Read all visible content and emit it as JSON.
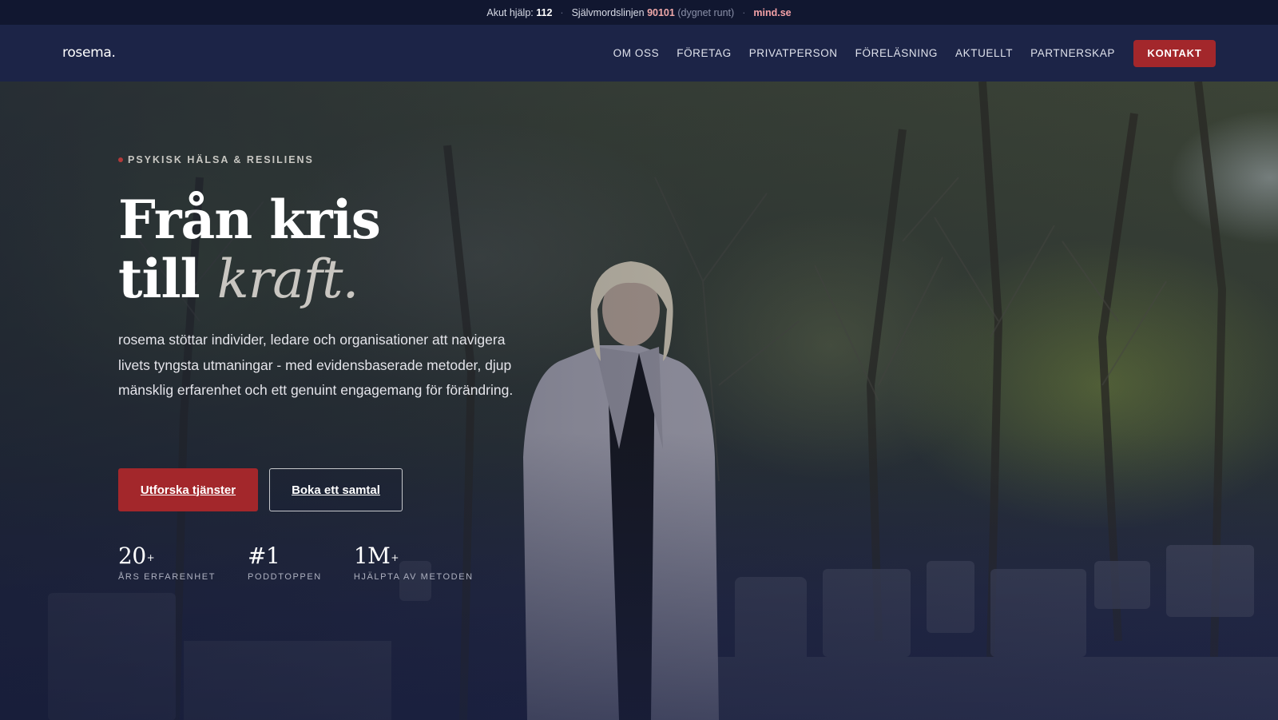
{
  "topbar": {
    "acute_label": "Akut hjälp:",
    "acute_number": "112",
    "separator": "·",
    "suicide_label": "Självmordslinjen",
    "suicide_number": "90101",
    "suicide_note": "(dygnet runt)",
    "link": "mind.se"
  },
  "nav": {
    "logo": "rosema.",
    "items": [
      "OM OSS",
      "FÖRETAG",
      "PRIVATPERSON",
      "FÖRELÄSNING",
      "AKTUELLT",
      "PARTNERSKAP"
    ],
    "cta": "KONTAKT"
  },
  "hero": {
    "eyebrow": "PSYKISK HÄLSA & RESILIENS",
    "headline_line1": "Från kris",
    "headline_line2_plain": "till",
    "headline_line2_italic": "kraft.",
    "lead": "rosema stöttar individer, ledare och organisationer att navigera livets tyngsta utmaningar - med evidensbaserade metoder, djup mänsklig erfarenhet och ett genuint engagemang för förändring.",
    "primary_button": "Utforska tjänster",
    "secondary_button": "Boka ett samtal",
    "stats": [
      {
        "value": "20",
        "sup": "+",
        "label": "ÅRS ERFARENHET"
      },
      {
        "value": "#1",
        "sup": "",
        "label": "PODDTOPPEN"
      },
      {
        "value": "1M",
        "sup": "+",
        "label": "HJÄLPTA AV METODEN"
      }
    ]
  },
  "colors": {
    "accent": "#a3272b",
    "navy": "#1c2447",
    "topbar": "#111730"
  }
}
